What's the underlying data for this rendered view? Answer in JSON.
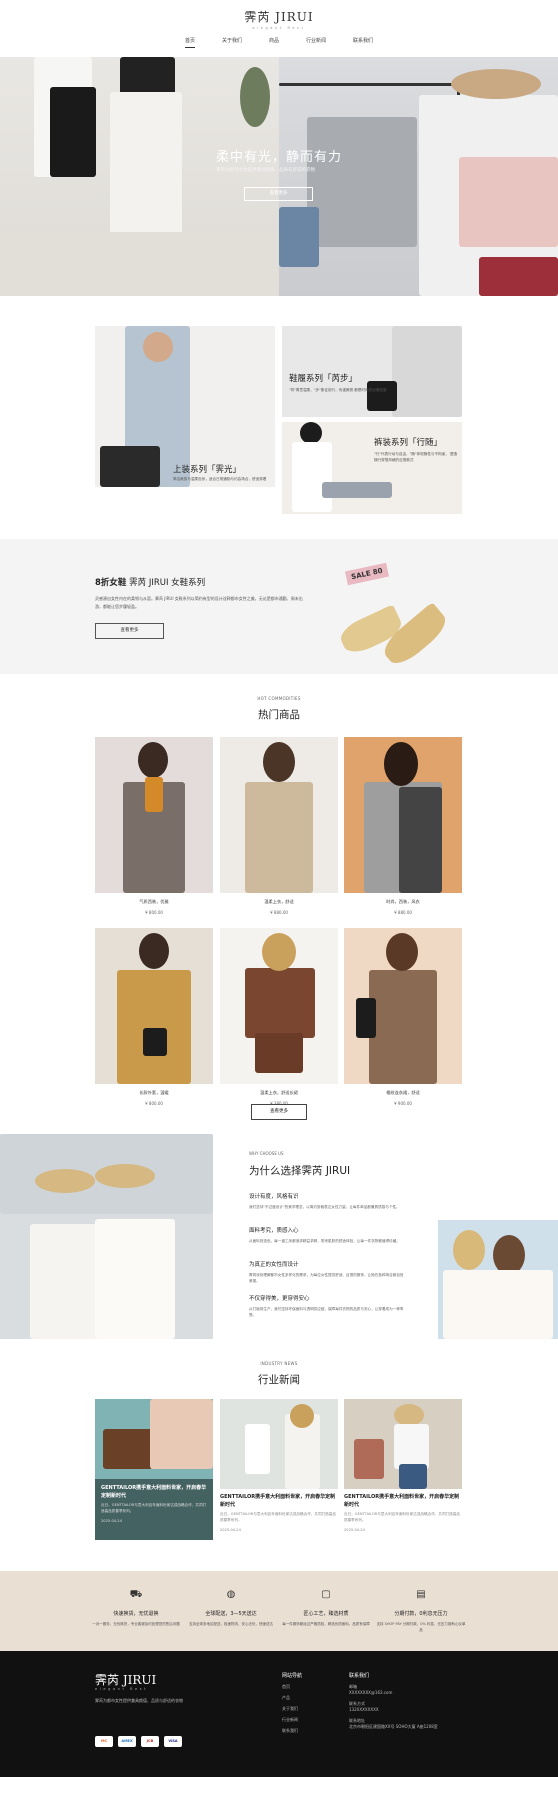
{
  "header": {
    "logo": "霁芮 JIRUI",
    "logo_sub": "elegant Rest",
    "nav": [
      "首页",
      "关于我们",
      "商品",
      "行业新闻",
      "联系我们"
    ]
  },
  "hero": {
    "title": "柔中有光，静而有力",
    "subtitle": "霁芮为都市女性提供兼具颜值、品质与舒适的衣物",
    "button": "查看更多"
  },
  "categories": [
    {
      "title": "上装系列「霁光」",
      "desc": "简洁裁剪与温柔色系，适合日常通勤与约会场合，舒适穿着"
    },
    {
      "title": "鞋履系列「芮步」",
      "desc": "\"芮\"寓意温柔，\"步\"象征前行，传递美丽\n都是时尚的优雅态度"
    },
    {
      "title": "裤装系列「行随」",
      "desc": "\"行\"代表行动与自由，\"随\"体现随性与不拘束，\n塑造随行穿搭风格的百搭款式"
    }
  ],
  "promo": {
    "title_bold": "8折女鞋",
    "title_rest": " 霁芮 JIRUI 女鞋系列",
    "desc": "灵感源自女性内在的柔韧与从容。霁芮 JIRUI 女鞋系列以简约有型的设计诠释都市女性之美，无论是都市通勤、周末出游，都能让您步履轻盈。",
    "button": "查看更多",
    "sale": "SALE",
    "sale_badge": "80"
  },
  "hot": {
    "en": "HOT COMMODITIES",
    "cn": "热门商品",
    "items": [
      {
        "name": "气质西装，优雅",
        "price": "¥ 800.00"
      },
      {
        "name": "温柔上衣，舒适",
        "price": "¥ 880.00"
      },
      {
        "name": "时尚，西装，风衣",
        "price": "¥ 880.00"
      },
      {
        "name": "长款外套，温暖",
        "price": "¥ 800.00"
      },
      {
        "name": "温柔上衣，舒适长裙",
        "price": "¥ 380.00"
      },
      {
        "name": "格纹连衣裙，舒适",
        "price": "¥ 900.00"
      }
    ],
    "more": "查看更多"
  },
  "why": {
    "en": "WHY CHOOSE US",
    "title": "为什么选择霁芮 JIRUI",
    "items": [
      {
        "title": "设计有度，风格有识",
        "desc": "我们坚持\"不过度设计\"的美学理念，以简约剪裁表达女性力量，让每件单品都兼具质感与个性。"
      },
      {
        "title": "面料考究，质感入心",
        "desc": "从面料到选色，每一道工序都追求精益求精，带来肌肤的舒适体验，让每一件衣物都值得珍藏。"
      },
      {
        "title": "为真正的女性而设计",
        "desc": "霁芮深刻理解都市女性多样化的需求，为每位女性提供舒适、百搭的服饰，让她在各种场合都自信美丽。"
      },
      {
        "title": "不仅穿得美，更穿得安心",
        "desc": "从打版到生产，我们坚持环保面料与透明供应链，保障每件衣物的品质与安心，让穿着成为一种享受。"
      }
    ]
  },
  "news": {
    "en": "INDUSTRY NEWS",
    "cn": "行业新闻",
    "items": [
      {
        "title": "GENTTAILOR携手意大利面料世家，开启春华定制新时代",
        "desc": "近日，GENTTAILOR与意大利百年面料世家达成战略合作，共同打造高品质春季系列。",
        "date": "2025-04-24"
      },
      {
        "title": "GENTTAILOR携手意大利面料世家，开启春华定制新时代",
        "desc": "近日，GENTTAILOR与意大利百年面料世家达成战略合作，共同打造高品质春季系列。",
        "date": "2025-04-24"
      },
      {
        "title": "GENTTAILOR携手意大利面料世家，开启春华定制新时代",
        "desc": "近日，GENTTAILOR与意大利百年面料世家达成战略合作，共同打造高品质春季系列。",
        "date": "2025-04-24"
      }
    ]
  },
  "features": [
    {
      "icon": "truck-icon",
      "title": "快速换货，无忧退换",
      "desc": "一对一服务，无忧换货，专业客服及时处理您的售后问题"
    },
    {
      "icon": "globe-icon",
      "title": "全球配送，3—5天送达",
      "desc": "支持全球多地区配送，极速物流，安心无忧，快速送达"
    },
    {
      "icon": "shirt-icon",
      "title": "匠心工艺，臻选材质",
      "desc": "每一件服饰都经过严格质检，精选优质面料，品质有保障"
    },
    {
      "icon": "bag-icon",
      "title": "分期付款，0利息无压力",
      "desc": "支持 SHOP PAY 分期付款，0% 利息，无压力拥有心仪单品"
    }
  ],
  "footer": {
    "logo": "霁芮 JIRUI",
    "logo_sub": "elegant Rest",
    "desc": "霁芮为都市女性提供兼具颜值、品质与舒适的衣物",
    "pay": [
      "MC",
      "AMEX",
      "JCB",
      "VISA"
    ],
    "nav_title": "网站导航",
    "nav": [
      "首页",
      "产品",
      "关于我们",
      "行业新闻",
      "联系我们"
    ],
    "contact_title": "联系我们",
    "contact": [
      {
        "label": "邮箱",
        "value": "XXXXXXXX@163.com"
      },
      {
        "label": "联系方式",
        "value": "132XXXXXXXX"
      },
      {
        "label": "联系地址",
        "value": "北京市朝阳区建国路XX号 SOHO大厦 A座1208室"
      }
    ]
  },
  "colors": {
    "accent_bg": "#eadfd3",
    "footer_bg": "#111111",
    "promo_bg": "#f4f4f4"
  }
}
